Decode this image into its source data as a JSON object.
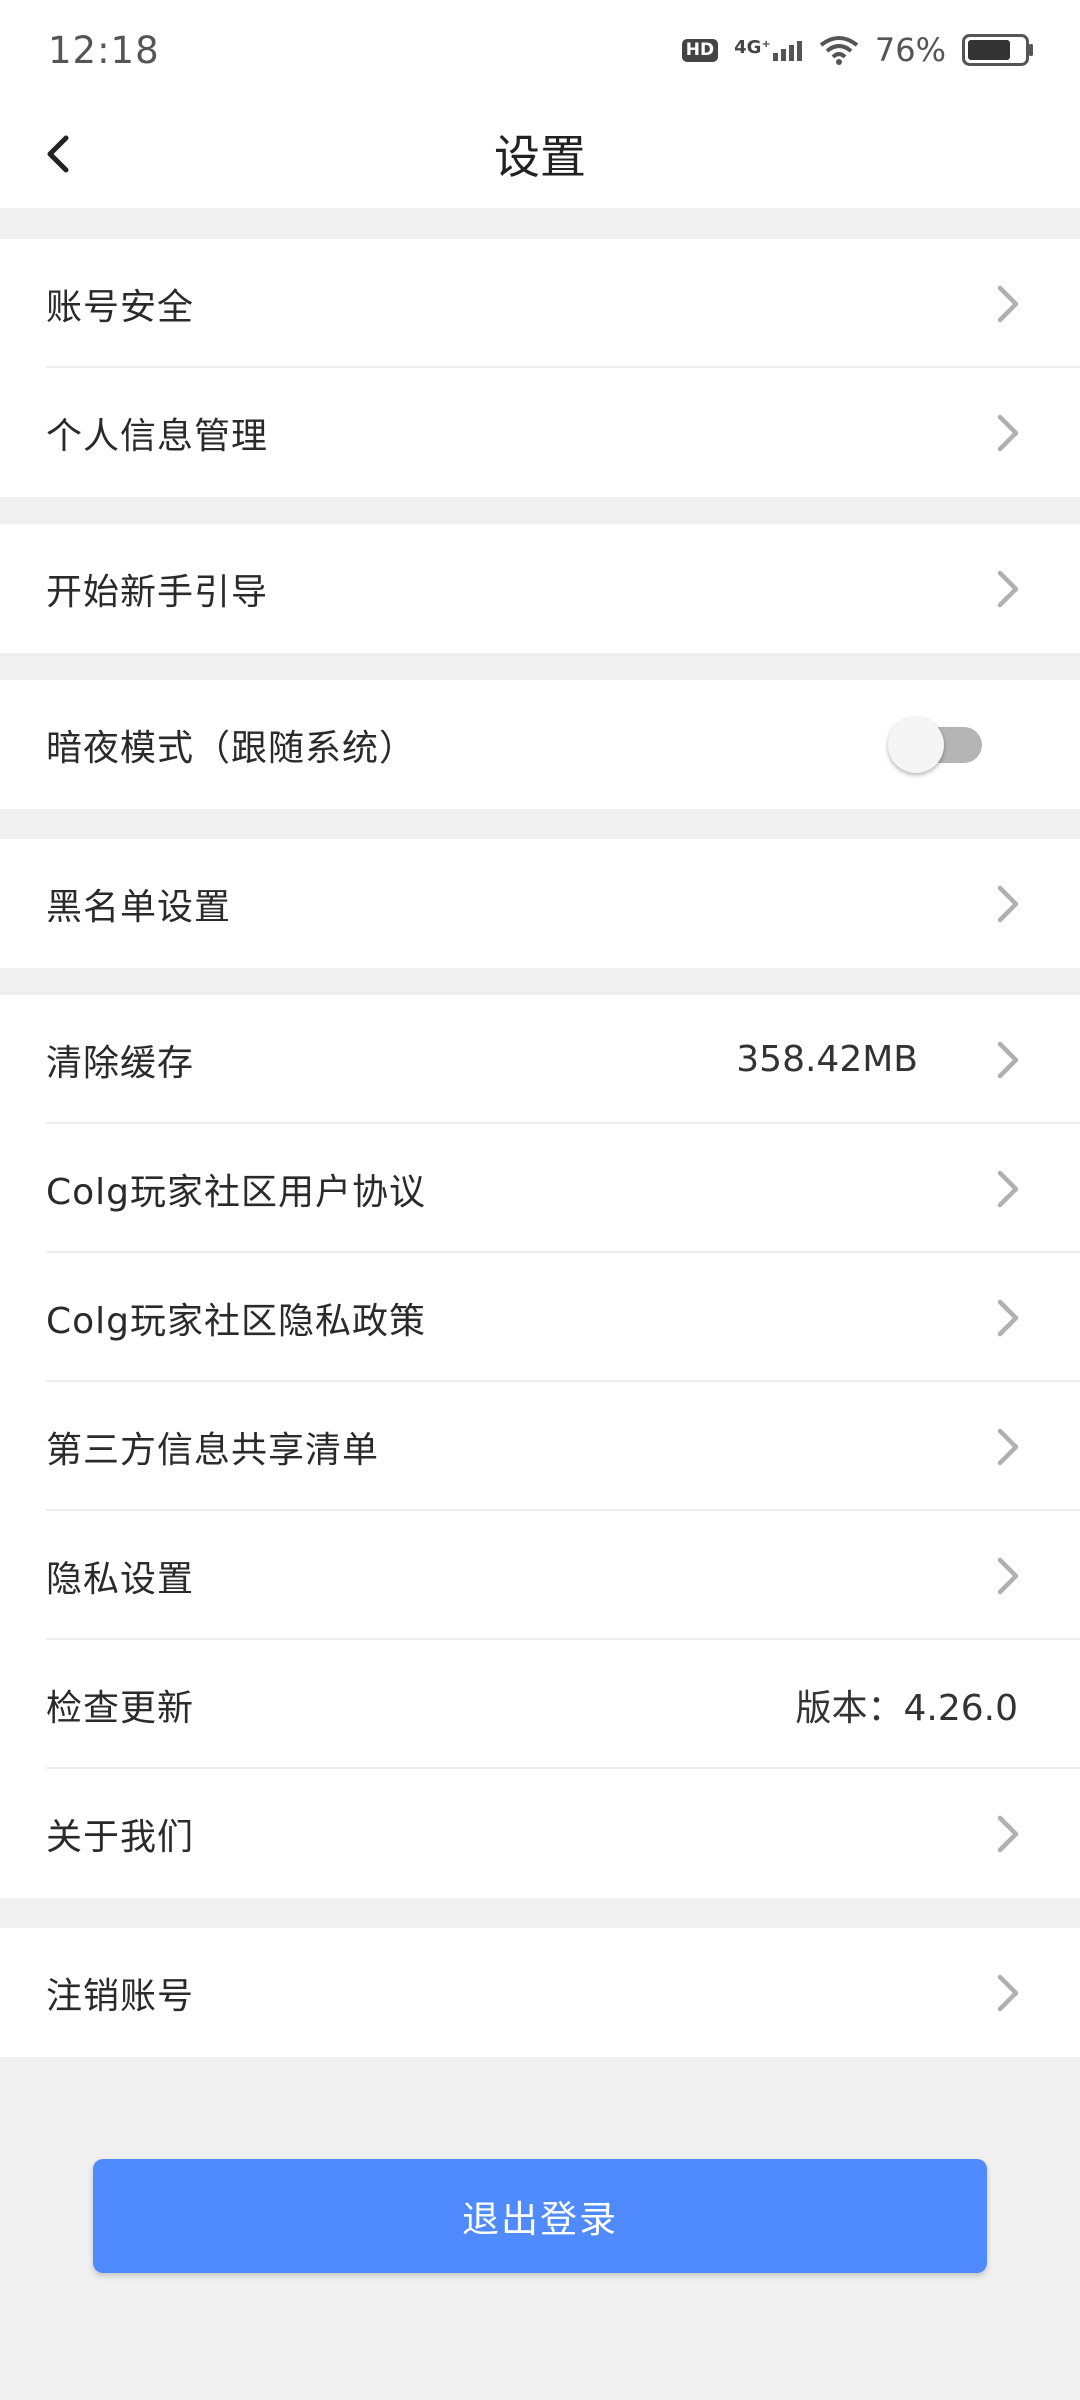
{
  "status_bar": {
    "time": "12:18",
    "hd_badge": "HD",
    "network": "4G⁺",
    "battery_percent": "76%",
    "battery_level": 0.76
  },
  "header": {
    "back_icon": "chevron-left-icon",
    "title": "设置"
  },
  "groups": {
    "account": {
      "security": "账号安全",
      "personal_info": "个人信息管理"
    },
    "guide": {
      "beginner_guide": "开始新手引导"
    },
    "dark_mode": {
      "label": "暗夜模式（跟随系统）",
      "enabled": false
    },
    "blacklist": {
      "label": "黑名单设置"
    },
    "misc": {
      "clear_cache": "清除缓存",
      "cache_size": "358.42MB",
      "user_agreement": "Colg玩家社区用户协议",
      "privacy_policy": "Colg玩家社区隐私政策",
      "third_party_sharing": "第三方信息共享清单",
      "privacy_settings": "隐私设置",
      "check_update": "检查更新",
      "version": "版本：4.26.0",
      "about_us": "关于我们"
    },
    "deregister": {
      "label": "注销账号"
    }
  },
  "logout_button": "退出登录",
  "colors": {
    "accent": "#4f8bff",
    "background": "#f0f0f0",
    "chevron": "#b0b0b0"
  }
}
